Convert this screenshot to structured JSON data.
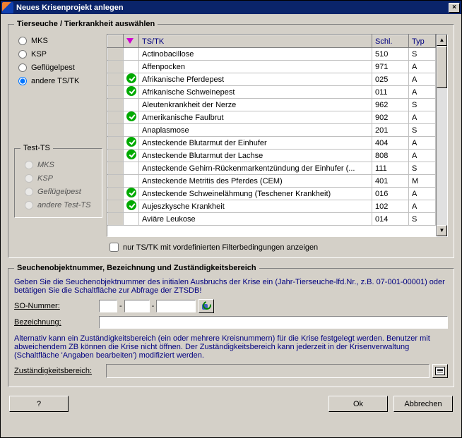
{
  "window": {
    "title": "Neues Krisenprojekt anlegen",
    "close_x": "×"
  },
  "group1": {
    "legend": "Tierseuche / Tierkrankheit auswählen",
    "radios": {
      "mks": "MKS",
      "ksp": "KSP",
      "gefluegelpest": "Geflügelpest",
      "andere": "andere TS/TK"
    },
    "test_legend": "Test-TS",
    "test_radios": {
      "mks": "MKS",
      "ksp": "KSP",
      "gefluegelpest": "Geflügelpest",
      "andere": "andere Test-TS"
    },
    "columns": {
      "tstk": "TS/TK",
      "schl": "Schl.",
      "typ": "Typ"
    },
    "rows": [
      {
        "check": false,
        "name": "Actinobacillose",
        "schl": "510",
        "typ": "S"
      },
      {
        "check": false,
        "name": "Affenpocken",
        "schl": "971",
        "typ": "A"
      },
      {
        "check": true,
        "name": "Afrikanische Pferdepest",
        "schl": "025",
        "typ": "A"
      },
      {
        "check": true,
        "name": "Afrikanische Schweinepest",
        "schl": "011",
        "typ": "A"
      },
      {
        "check": false,
        "name": "Aleutenkrankheit der Nerze",
        "schl": "962",
        "typ": "S"
      },
      {
        "check": true,
        "name": "Amerikanische Faulbrut",
        "schl": "902",
        "typ": "A"
      },
      {
        "check": false,
        "name": "Anaplasmose",
        "schl": "201",
        "typ": "S"
      },
      {
        "check": true,
        "name": "Ansteckende Blutarmut der Einhufer",
        "schl": "404",
        "typ": "A"
      },
      {
        "check": true,
        "name": "Ansteckende Blutarmut der Lachse",
        "schl": "808",
        "typ": "A"
      },
      {
        "check": false,
        "name": "Ansteckende Gehirn-Rückenmarkentzündung der Einhufer (...",
        "schl": "111",
        "typ": "S"
      },
      {
        "check": false,
        "name": "Ansteckende Metritis des Pferdes (CEM)",
        "schl": "401",
        "typ": "M"
      },
      {
        "check": true,
        "name": "Ansteckende Schweinelähmung (Teschener Krankheit)",
        "schl": "016",
        "typ": "A"
      },
      {
        "check": true,
        "name": "Aujeszkysche Krankheit",
        "schl": "102",
        "typ": "A"
      },
      {
        "check": false,
        "name": "Aviäre Leukose",
        "schl": "014",
        "typ": "S"
      }
    ],
    "filter_label": "nur TS/TK mit vordefinierten Filterbedingungen anzeigen"
  },
  "group2": {
    "legend": "Seuchenobjektnummer, Bezeichnung und Zuständigkeitsbereich",
    "help1": "Geben Sie die Seuchenobjektnummer des initialen Ausbruchs der Krise ein (Jahr-Tierseuche-lfd.Nr., z.B. 07-001-00001) oder betätigen Sie die Schaltfläche zur Abfrage der ZTSDB!",
    "so_label": "SO-Nummer:",
    "dash": "-",
    "bez_label": "Bezeichnung:",
    "help2": "Alternativ kann ein Zuständigkeitsbereich (ein oder mehrere Kreisnummern) für die Krise festgelegt werden. Benutzer mit abweichendem ZB können die Krise nicht öffnen. Der Zuständigkeitsbereich kann jederzeit in der Krisenverwaltung (Schaltfläche 'Angaben bearbeiten') modifiziert werden.",
    "zb_label": "Zuständigkeitsbereich:"
  },
  "buttons": {
    "help": "?",
    "ok": "Ok",
    "cancel": "Abbrechen"
  },
  "scroll": {
    "up": "▲",
    "down": "▼"
  }
}
